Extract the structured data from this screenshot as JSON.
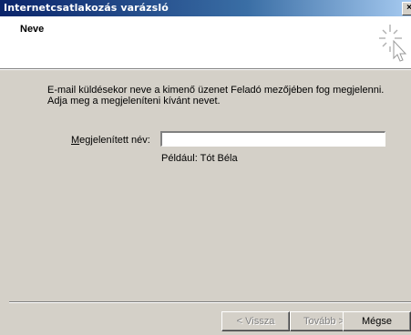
{
  "window": {
    "title": "Internetcsatlakozás varázsló",
    "close_glyph": "×"
  },
  "header": {
    "title": "Neve",
    "icon": "wizard-cursor-icon"
  },
  "main": {
    "description": "E-mail küldésekor neve a kimenő üzenet Feladó mezőjében fog megjelenni. Adja meg a megjeleníteni kívánt nevet.",
    "field_label": "Megjelenített név:",
    "field_label_mnemonic": "M",
    "field_label_rest": "egjelenített név:",
    "field_value": "",
    "example": "Például: Tót Béla"
  },
  "footer": {
    "back_label": "< Vissza",
    "next_label": "Tovább >",
    "cancel_label": "Mégse"
  }
}
